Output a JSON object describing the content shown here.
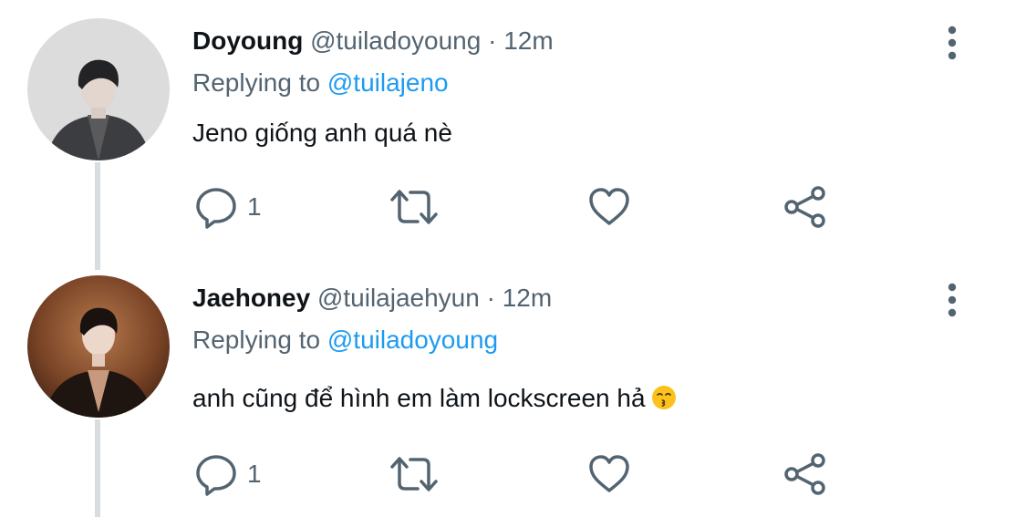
{
  "tweets": [
    {
      "name": "Doyoung",
      "handle": "@tuiladoyoung",
      "separator": "·",
      "time": "12m",
      "replying_prefix": "Replying to",
      "replying_to": "@tuilajeno",
      "text": "Jeno giống anh quá nè",
      "reply_count": "1"
    },
    {
      "name": "Jaehoney",
      "handle": "@tuilajaehyun",
      "separator": "·",
      "time": "12m",
      "replying_prefix": "Replying to",
      "replying_to": "@tuiladoyoung",
      "text": "anh cũng để hình em làm lockscreen hả",
      "text_emoji": "kissing-face-emoji",
      "reply_count": "1"
    }
  ],
  "icons": {
    "reply": "speech-bubble-icon",
    "retweet": "retweet-arrows-icon",
    "like": "heart-icon",
    "share": "share-nodes-icon",
    "more": "vertical-dots-icon"
  },
  "colors": {
    "text": "#0f1419",
    "secondary": "#536471",
    "mention": "#1d9bf0",
    "thread_line": "#d9dde0"
  }
}
